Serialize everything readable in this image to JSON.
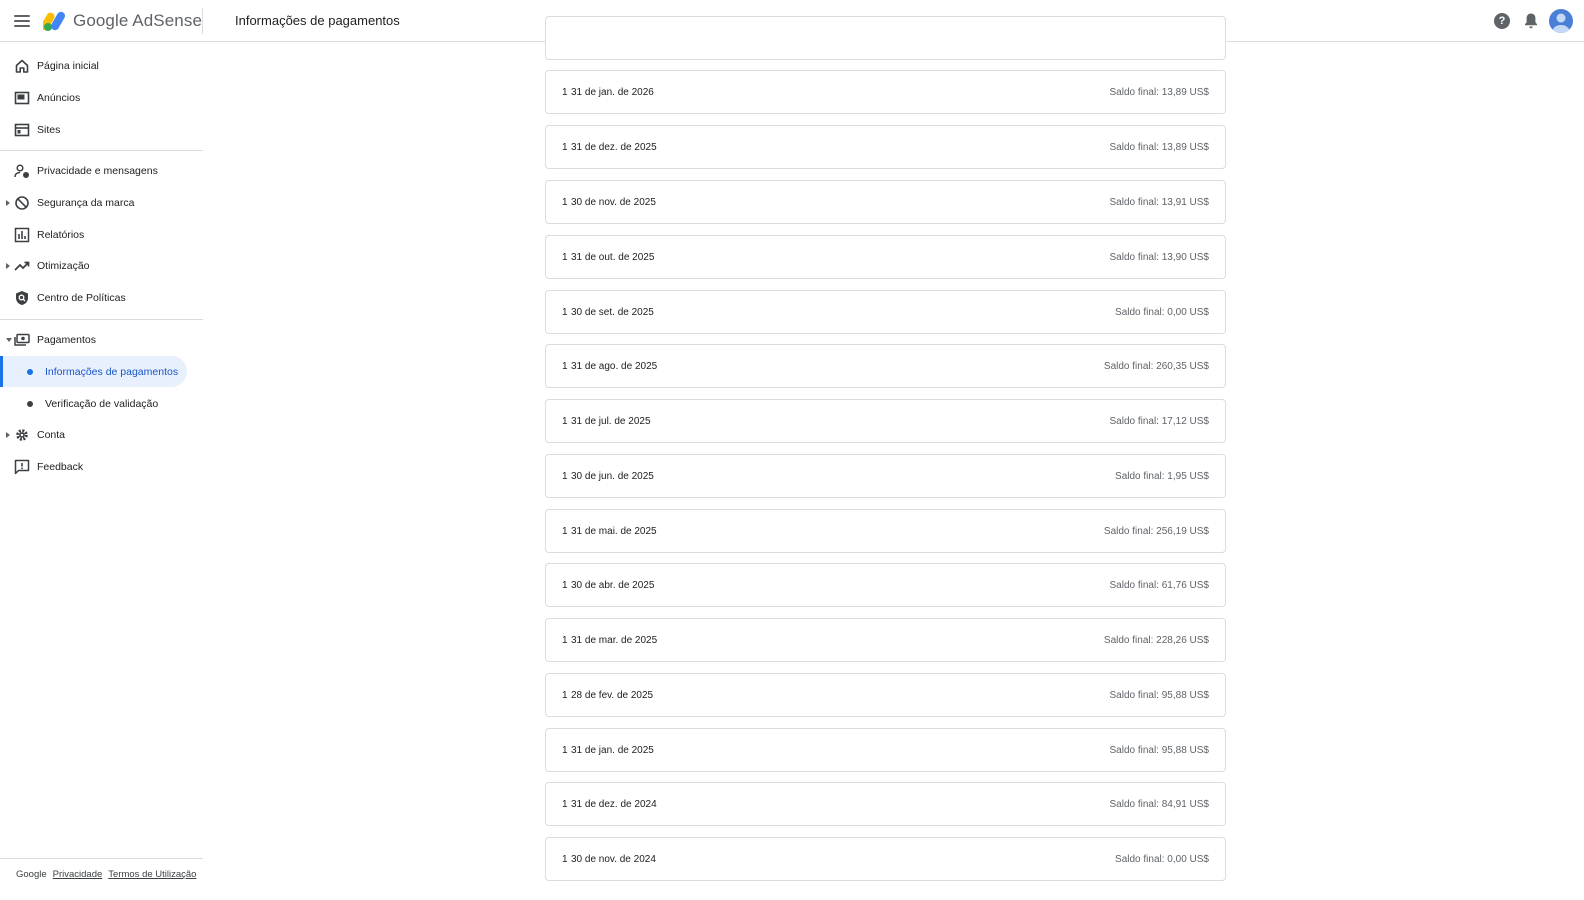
{
  "header": {
    "app_name": "Google AdSense",
    "page_title": "Informações de pagamentos",
    "help_glyph": "?"
  },
  "sidebar": {
    "items": [
      {
        "label": "Página inicial",
        "icon": "home-icon"
      },
      {
        "label": "Anúncios",
        "icon": "ads-icon"
      },
      {
        "label": "Sites",
        "icon": "sites-icon"
      },
      {
        "label": "Privacidade e mensagens",
        "icon": "privacy-messaging-icon"
      },
      {
        "label": "Segurança da marca",
        "icon": "block-icon"
      },
      {
        "label": "Relatórios",
        "icon": "reports-icon"
      },
      {
        "label": "Otimização",
        "icon": "trending-icon"
      },
      {
        "label": "Centro de Políticas",
        "icon": "policy-icon"
      },
      {
        "label": "Pagamentos",
        "icon": "payments-icon"
      },
      {
        "label": "Conta",
        "icon": "gear-icon"
      },
      {
        "label": "Feedback",
        "icon": "feedback-icon"
      }
    ],
    "payments_sub": [
      {
        "label": "Informações de pagamentos",
        "active": true
      },
      {
        "label": "Verificação de validação",
        "active": false
      }
    ],
    "footer": {
      "brand": "Google",
      "privacy": "Privacidade",
      "terms": "Termos de Utilização"
    }
  },
  "statements": [
    {
      "count": "1",
      "date": "31 de jan. de 2026",
      "balance": "Saldo final: 13,89 US$"
    },
    {
      "count": "1",
      "date": "31 de dez. de 2025",
      "balance": "Saldo final: 13,89 US$"
    },
    {
      "count": "1",
      "date": "30 de nov. de 2025",
      "balance": "Saldo final: 13,91 US$"
    },
    {
      "count": "1",
      "date": "31 de out. de 2025",
      "balance": "Saldo final: 13,90 US$"
    },
    {
      "count": "1",
      "date": "30 de set. de 2025",
      "balance": "Saldo final: 0,00 US$"
    },
    {
      "count": "1",
      "date": "31 de ago. de 2025",
      "balance": "Saldo final: 260,35 US$"
    },
    {
      "count": "1",
      "date": "31 de jul. de 2025",
      "balance": "Saldo final: 17,12 US$"
    },
    {
      "count": "1",
      "date": "30 de jun. de 2025",
      "balance": "Saldo final: 1,95 US$"
    },
    {
      "count": "1",
      "date": "31 de mai. de 2025",
      "balance": "Saldo final: 256,19 US$"
    },
    {
      "count": "1",
      "date": "30 de abr. de 2025",
      "balance": "Saldo final: 61,76 US$"
    },
    {
      "count": "1",
      "date": "31 de mar. de 2025",
      "balance": "Saldo final: 228,26 US$"
    },
    {
      "count": "1",
      "date": "28 de fev. de 2025",
      "balance": "Saldo final: 95,88 US$"
    },
    {
      "count": "1",
      "date": "31 de jan. de 2025",
      "balance": "Saldo final: 95,88 US$"
    },
    {
      "count": "1",
      "date": "31 de dez. de 2024",
      "balance": "Saldo final: 84,91 US$"
    },
    {
      "count": "1",
      "date": "30 de nov. de 2024",
      "balance": "Saldo final: 0,00 US$"
    }
  ],
  "colors": {
    "accent": "#1a73e8",
    "active_bg": "#e8f0fe",
    "divider": "#dadce0"
  }
}
